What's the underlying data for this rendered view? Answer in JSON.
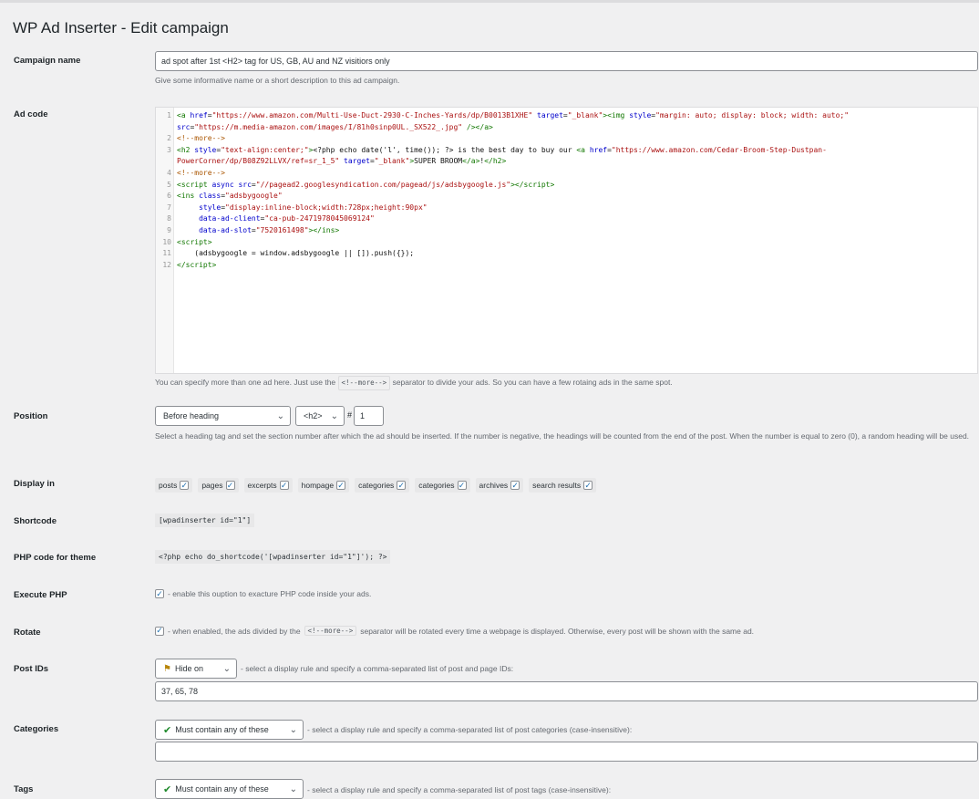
{
  "page_title": "WP Ad Inserter - Edit campaign",
  "campaign_name": {
    "label": "Campaign name",
    "value": "ad spot after 1st <H2> tag for US, GB, AU and NZ visitiors only",
    "help": "Give some informative name or a short description to this ad campaign."
  },
  "ad_code": {
    "label": "Ad code",
    "line_numbers": [
      "1",
      "",
      "2",
      "3",
      "",
      "4",
      "5",
      "6",
      "7",
      "8",
      "9",
      "10",
      "11",
      "12"
    ],
    "help_before": "You can specify more than one ad here. Just use the",
    "help_separator": "<!--more-->",
    "help_after": "separator to divide your ads. So you can have a few rotaing ads in the same spot."
  },
  "position": {
    "label": "Position",
    "heading_select": "Before heading",
    "tag_select": "<h2>",
    "hash": "#",
    "number": "1",
    "help": "Select a heading tag and set the section number after which the ad should be inserted. If the number is negative, the headings will be counted from the end of the post. When the number is equal to zero (0), a random heading will be used."
  },
  "display_in": {
    "label": "Display in",
    "options": [
      {
        "label": "posts",
        "checked": true
      },
      {
        "label": "pages",
        "checked": true
      },
      {
        "label": "excerpts",
        "checked": true
      },
      {
        "label": "hompage",
        "checked": true
      },
      {
        "label": "categories",
        "checked": true
      },
      {
        "label": "categories",
        "checked": true
      },
      {
        "label": "archives",
        "checked": true
      },
      {
        "label": "search results",
        "checked": true
      }
    ]
  },
  "shortcode": {
    "label": "Shortcode",
    "value": "[wpadinserter id=\"1\"]"
  },
  "php_code": {
    "label": "PHP code for theme",
    "value": "<?php echo do_shortcode('[wpadinserter id=\"1\"]'); ?>"
  },
  "execute_php": {
    "label": "Execute PHP",
    "text": "- enable this ouption to exacture PHP code inside your ads."
  },
  "rotate": {
    "label": "Rotate",
    "text_before": "- when enabled, the ads divided by the",
    "separator": "<!--more-->",
    "text_after": "separator will be rotated every time a webpage is displayed. Otherwise, every post will be shown with the same ad."
  },
  "post_ids": {
    "label": "Post IDs",
    "rule": "Hide on",
    "help": "- select a display rule and specify a comma-separated list of post and page IDs:",
    "value": "37, 65, 78"
  },
  "categories": {
    "label": "Categories",
    "rule": "Must contain any of these",
    "help": "- select a display rule and specify a comma-separated list of post categories (case-insensitive):",
    "value": ""
  },
  "tags": {
    "label": "Tags",
    "rule": "Must contain any of these",
    "help": "- select a display rule and specify a comma-separated list of post tags (case-insensitive):"
  },
  "colors": {
    "accent": "#2271b1",
    "green_check": "#1e8a2b",
    "background": "#f0f0f1"
  }
}
